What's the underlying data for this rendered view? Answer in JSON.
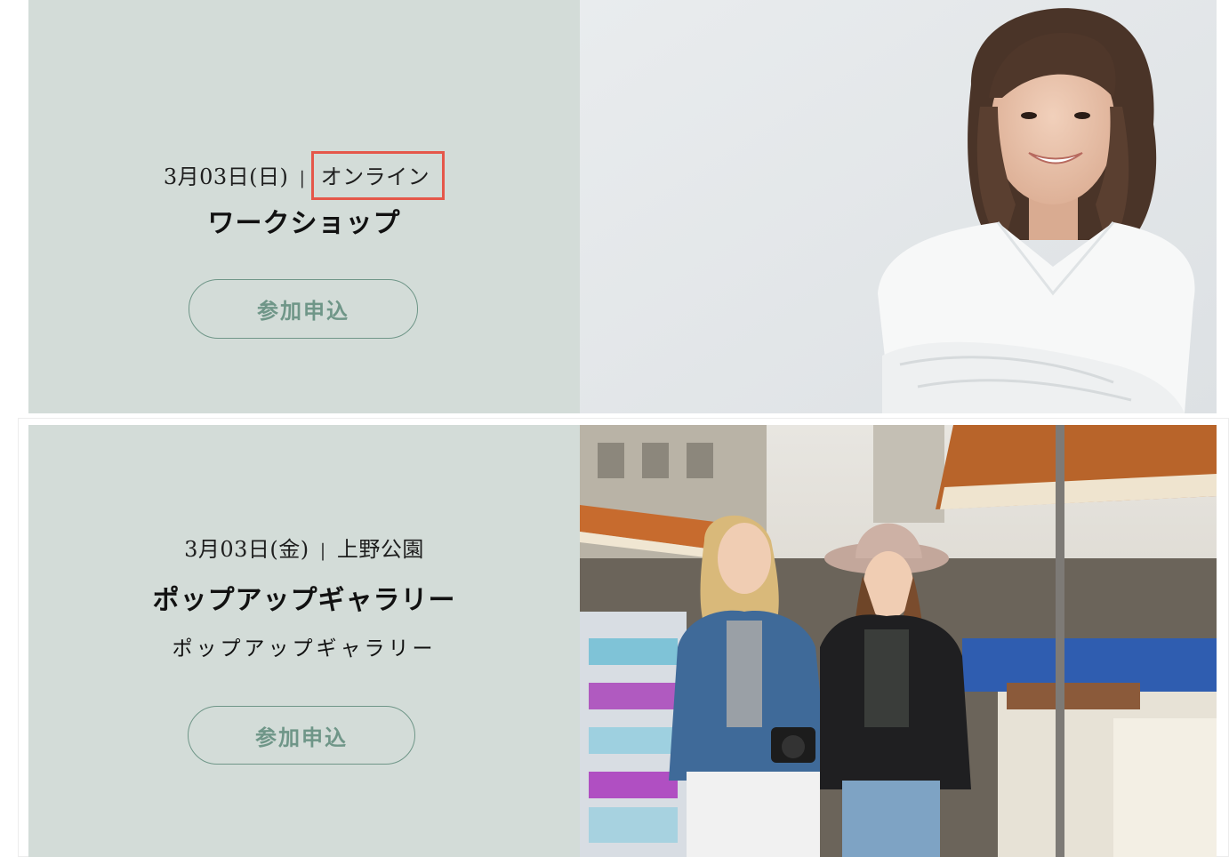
{
  "events": [
    {
      "date": "3月03日(日)",
      "separator": "|",
      "location": "オンライン",
      "title": "ワークショップ",
      "button_label": "参加申込",
      "image": "portrait-woman-white-blouse"
    },
    {
      "date": "3月03日(金)",
      "separator": "|",
      "location": "上野公園",
      "title": "ポップアップギャラリー",
      "subtitle": "ポップアップギャラリー",
      "button_label": "参加申込",
      "image": "two-women-at-street-market"
    }
  ],
  "colors": {
    "panel_bg": "#d3dcd8",
    "button_accent": "#6f9688",
    "highlight": "#e5574a"
  }
}
